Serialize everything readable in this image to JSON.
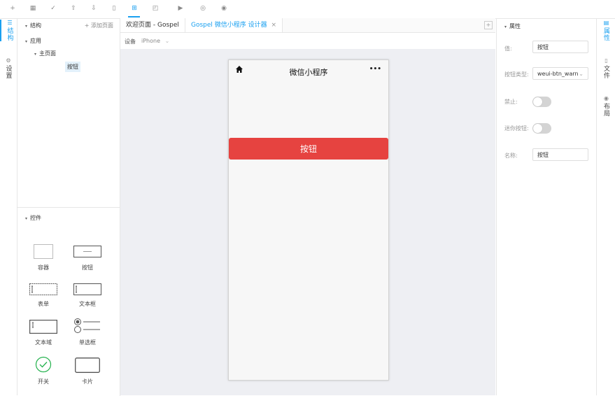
{
  "toolbar": {
    "icons": [
      "plus-icon",
      "grid-icon",
      "check-icon",
      "upload-icon",
      "download-icon",
      "file-icon",
      "component-icon",
      "layout-icon",
      "play-icon",
      "code-icon",
      "eye-icon"
    ],
    "glyphs": [
      "+",
      "▦",
      "✓",
      "⇧",
      "⇩",
      "▯",
      "⊞",
      "◰",
      "▶",
      "◎",
      "◉"
    ],
    "active_index": 6
  },
  "left_rail": {
    "structure_label": "结构",
    "settings_label": "设置"
  },
  "structure": {
    "title": "结构",
    "add_page": "+ 添加页面",
    "tree": {
      "app": "应用",
      "main_page": "主页面",
      "button": "按钮"
    }
  },
  "controls": {
    "title": "控件",
    "items": [
      {
        "label": "容器"
      },
      {
        "label": "按钮"
      },
      {
        "label": "表单"
      },
      {
        "label": "文本框"
      },
      {
        "label": "文本域"
      },
      {
        "label": "单选框"
      },
      {
        "label": "开关"
      },
      {
        "label": "卡片"
      }
    ]
  },
  "editor": {
    "tabs": [
      {
        "label": "欢迎页面 - Gospel"
      },
      {
        "label": "Gospel 微信小程序 设计器"
      }
    ],
    "tab_close": "×",
    "tab_add": "+",
    "device_label": "设备",
    "device_value": "iPhone",
    "phone": {
      "title": "微信小程序",
      "more": "•••",
      "button_text": "按钮"
    }
  },
  "properties": {
    "title": "属性",
    "value_label": "值:",
    "value": "按钮",
    "type_label": "按钮类型:",
    "type_value": "weui-btn_warn",
    "disabled_label": "禁止:",
    "mini_label": "迷你按钮:",
    "name_label": "名称:",
    "name_value": "按钮"
  },
  "right_rail": {
    "attr_label": "属性",
    "file_label": "文件",
    "layout_label": "布局"
  },
  "colors": {
    "accent": "#1aa0f0",
    "warn": "#e64340",
    "canvas": "#eeeff3"
  }
}
